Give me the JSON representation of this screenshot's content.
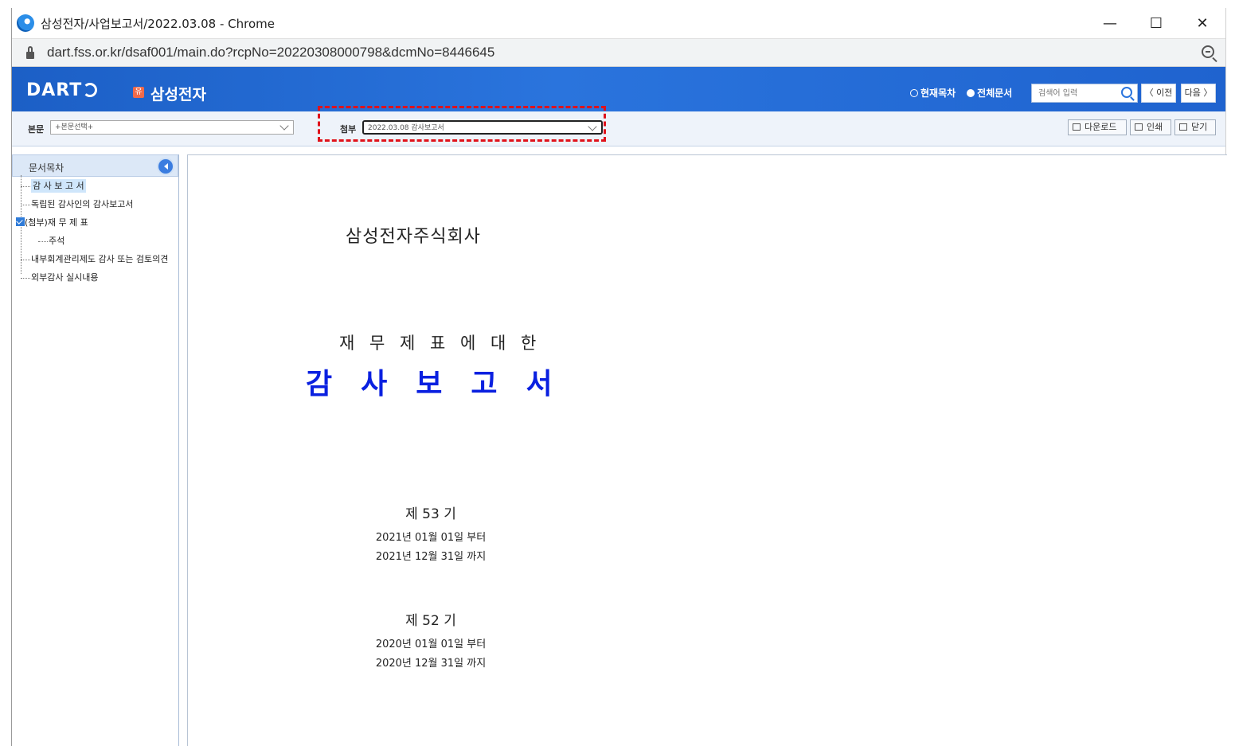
{
  "window": {
    "title": "삼성전자/사업보고서/2022.03.08 - Chrome",
    "minimize": "—",
    "maximize": "☐",
    "close": "✕"
  },
  "address": {
    "url": "dart.fss.or.kr/dsaf001/main.do?rcpNo=20220308000798&dcmNo=8446645"
  },
  "header": {
    "logo": "DART",
    "company_badge": "유",
    "company": "삼성전자",
    "radio_current": "현재목차",
    "radio_all": "전체문서",
    "search_placeholder": "검색어 입력",
    "prev": "〈 이전",
    "next": "다음 〉"
  },
  "selectors": {
    "main_label": "본문",
    "main_value": "+본문선택+",
    "attach_label": "첨부",
    "attach_value": "2022.03.08  감사보고서",
    "download": "다운로드",
    "print": "인쇄",
    "close": "닫기"
  },
  "sidebar": {
    "title": "문서목차",
    "items": [
      {
        "label": "감 사 보 고 서"
      },
      {
        "label": "독립된 감사인의 감사보고서"
      },
      {
        "label": "(첨부)재 무 제 표"
      },
      {
        "label": "주석"
      },
      {
        "label": "내부회계관리제도 감사 또는 검토의견"
      },
      {
        "label": "외부감사 실시내용"
      }
    ]
  },
  "document": {
    "company": "삼성전자주식회사",
    "subtitle": "재 무 제 표 에 대 한",
    "title": "감사보고서",
    "periods": [
      {
        "term": "제 53 기",
        "from": "2021년 01월 01일  부터",
        "to": "2021년 12월 31일  까지"
      },
      {
        "term": "제 52 기",
        "from": "2020년 01월 01일  부터",
        "to": "2020년 12월 31일  까지"
      }
    ]
  },
  "colors": {
    "header_blue": "#2a74dd",
    "title_blue": "#0a20e0",
    "highlight_red": "#e0121b"
  }
}
